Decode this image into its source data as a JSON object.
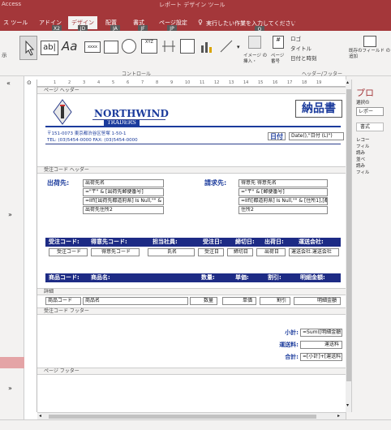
{
  "app": {
    "left_title": "Access",
    "center_title": "レポート デザイン ツール"
  },
  "tabs": [
    {
      "label": "ス ツール",
      "key": ""
    },
    {
      "label": "アドイン",
      "key": "X2"
    },
    {
      "label": "デザイン",
      "key": "JD"
    },
    {
      "label": "配置",
      "key": "JA"
    },
    {
      "label": "書式",
      "key": "JF"
    },
    {
      "label": "ページ設定",
      "key": "JP"
    }
  ],
  "tell_me": {
    "text": "実行したい作業を入力してください",
    "key": "Q"
  },
  "ribbon": {
    "left_label": "示",
    "controls_group": "コントロール",
    "insert_image": "イメージ の挿入・",
    "page_number": "ページ 番号",
    "logo": "ロゴ",
    "title": "タイトル",
    "datetime": "日付と時刻",
    "header_footer_group": "ヘッダー/フッター",
    "add_existing_field": "既存のフィールド の追加"
  },
  "ruler_numbers": [
    "1",
    "2",
    "3",
    "4",
    "5",
    "6",
    "7",
    "8",
    "9",
    "10",
    "11",
    "12",
    "13",
    "14",
    "15",
    "16",
    "17",
    "18",
    "19"
  ],
  "sections": {
    "page_header": "ページ ヘッダー",
    "order_header": "受注コード ヘッダー",
    "detail": "詳細",
    "order_footer": "受注コード フッター",
    "page_footer": "ページ フッター"
  },
  "report": {
    "company": "NORTHWIND",
    "company_sub": "TRADERS",
    "doc_title": "納品書",
    "address_line": "〒151-0073 東京都渋谷区笹塚 1-50-1",
    "tel_line": "TEL: (03)5454-0000 FAX: (03)5454-0000",
    "date_label": "日付",
    "date_field": "Date(),\"日付 (L)\")",
    "ship_label": "出荷先:",
    "bill_label": "請求先:",
    "ship_fields": [
      "出荷先名",
      "=\"〒\" & [出荷先郵便番号]",
      "=IIf([出荷先都道府県] Is Null,\"\" & [出荷",
      "出荷先住所2"
    ],
    "bill_fields": [
      "得意先 得意先名",
      "=\"〒\" & [郵便番号]",
      "=IIf([都道府県] Is Null,\"\" & [住所1],[都道",
      "住所2"
    ],
    "order_headers": [
      "受注コード:",
      "得意先コード:",
      "担当社員:",
      "受注日:",
      "締切日:",
      "出荷日:",
      "運送会社:"
    ],
    "order_fields": [
      "受注コード",
      "得意先コード",
      "氏名",
      "受注日",
      "締切日",
      "出荷日",
      "運送会社.運送会社"
    ],
    "item_headers": [
      "商品コード:",
      "商品名:",
      "数量:",
      "単価:",
      "割引:",
      "明細金額:"
    ],
    "detail_fields": [
      "商品コード",
      "商品名",
      "数量",
      "単価",
      "割引",
      "明細金額"
    ],
    "subtotal_label": "小計:",
    "subtotal_field": "=Sum([明細金額])",
    "shipping_label": "運送料:",
    "shipping_field": "運送料",
    "total_label": "合計:",
    "total_field": "=[小計]+[運送料]"
  },
  "right_pane": {
    "title": "プロ",
    "select_type": "選択の",
    "selector": "レポー",
    "tab": "書式",
    "lines": [
      "レコー",
      "フィル",
      "読み",
      "並べ",
      "読み",
      "フィル"
    ]
  },
  "colors": {
    "accent": "#a4373a",
    "navy": "#1d2b85",
    "label_blue": "#1b3b9c"
  }
}
